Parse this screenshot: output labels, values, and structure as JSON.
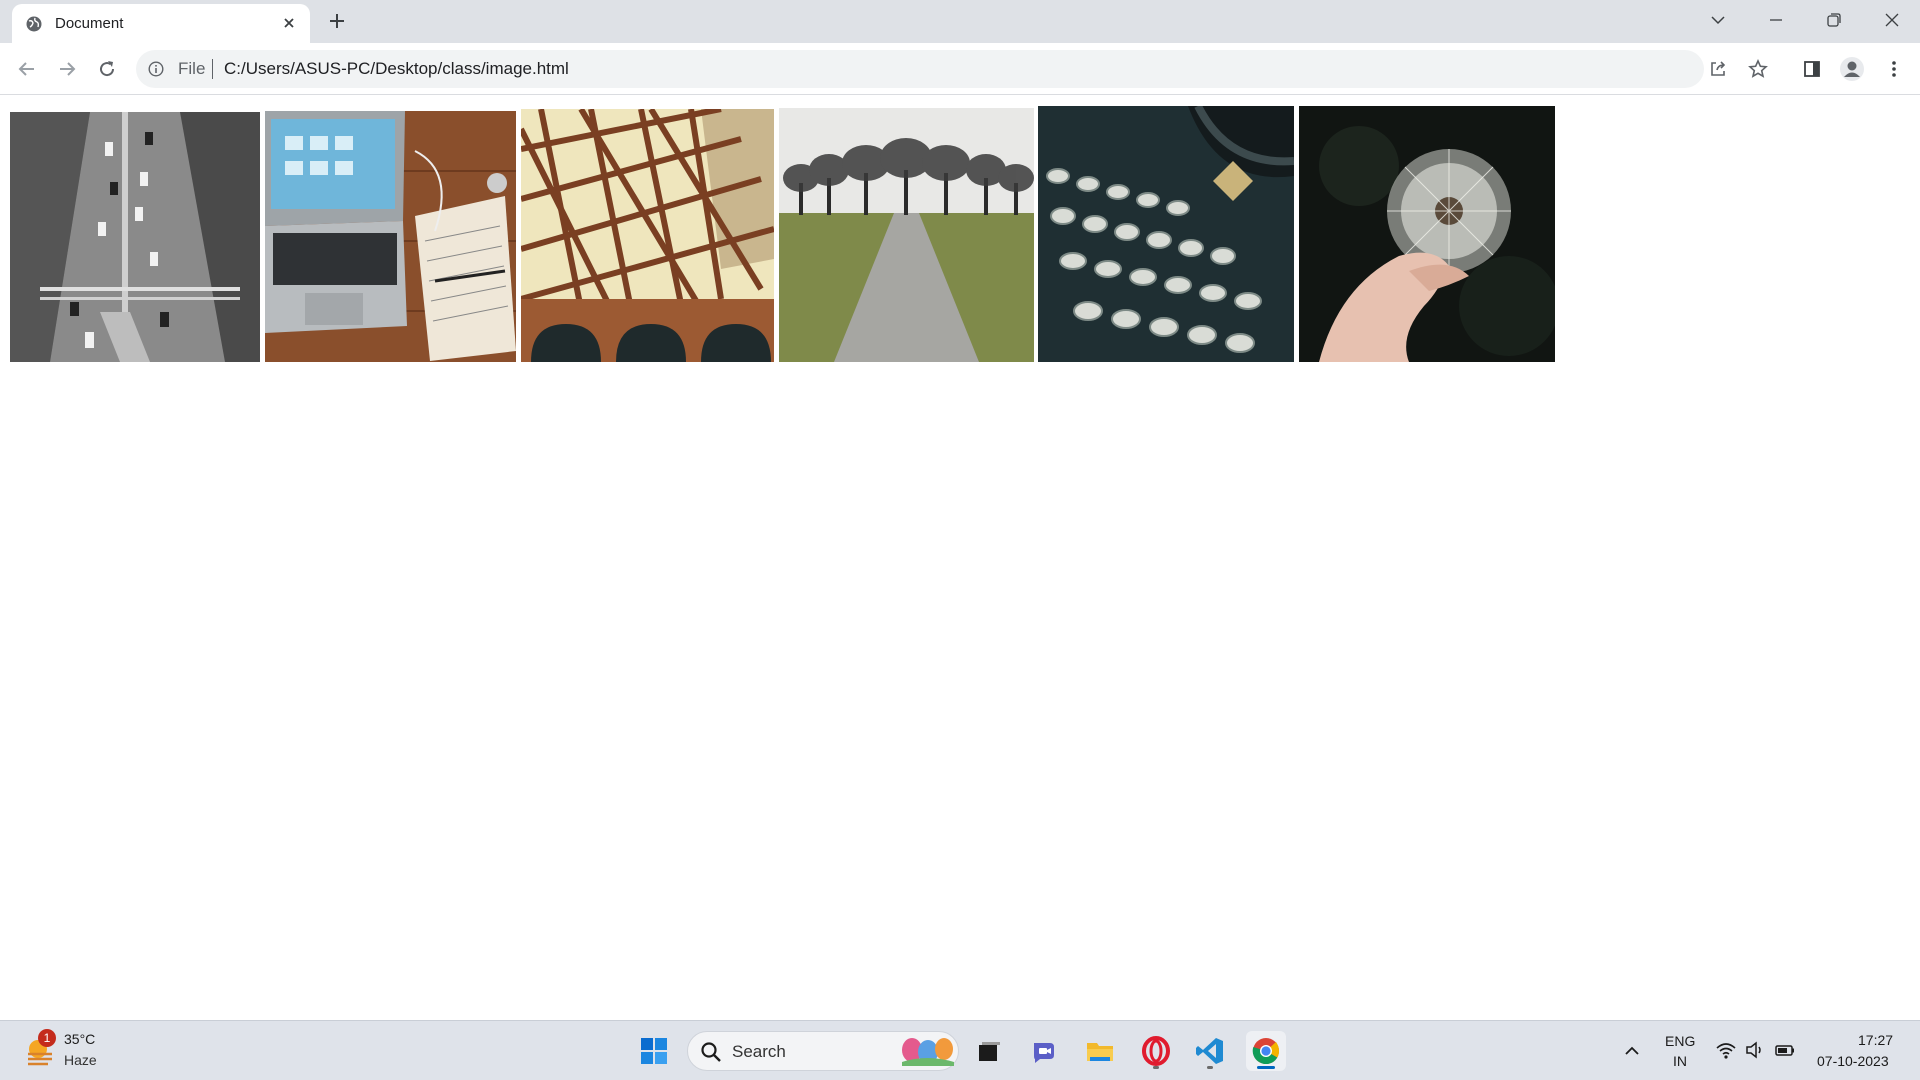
{
  "browser": {
    "tab": {
      "title": "Document",
      "favicon": "globe-icon"
    },
    "new_tab_icon": "plus-icon",
    "window_controls": [
      "tab-search-icon",
      "minimize-icon",
      "restore-icon",
      "close-icon"
    ]
  },
  "toolbar": {
    "back_icon": "back-arrow-icon",
    "forward_icon": "forward-arrow-icon",
    "reload_icon": "reload-icon",
    "omnibox": {
      "scheme_label": "File",
      "url": "C:/Users/ASUS-PC/Desktop/class/image.html"
    },
    "right_icons": [
      "share-icon",
      "bookmark-star-icon",
      "side-panel-icon",
      "profile-icon",
      "menu-icon"
    ]
  },
  "page": {
    "images": [
      {
        "subject": "city-street-aerial"
      },
      {
        "subject": "laptop-notebook-desk"
      },
      {
        "subject": "bridge-steel-structure"
      },
      {
        "subject": "tree-lined-path"
      },
      {
        "subject": "vintage-typewriter"
      },
      {
        "subject": "dandelion-in-hand"
      }
    ]
  },
  "taskbar": {
    "weather": {
      "temp": "35°C",
      "desc": "Haze",
      "badge": "1"
    },
    "search": {
      "placeholder": "Search"
    },
    "apps": [
      "start",
      "search",
      "task-view",
      "teams-chat",
      "file-explorer",
      "opera",
      "vscode",
      "chrome"
    ],
    "tray": {
      "lang_line1": "ENG",
      "lang_line2": "IN",
      "time": "17:27",
      "date": "07-10-2023"
    }
  },
  "colors": {
    "tabstrip_bg": "#dee1e6",
    "omnibox_bg": "#f1f3f4",
    "taskbar_bg": "#dfe3ea",
    "accent": "#0067c0"
  }
}
